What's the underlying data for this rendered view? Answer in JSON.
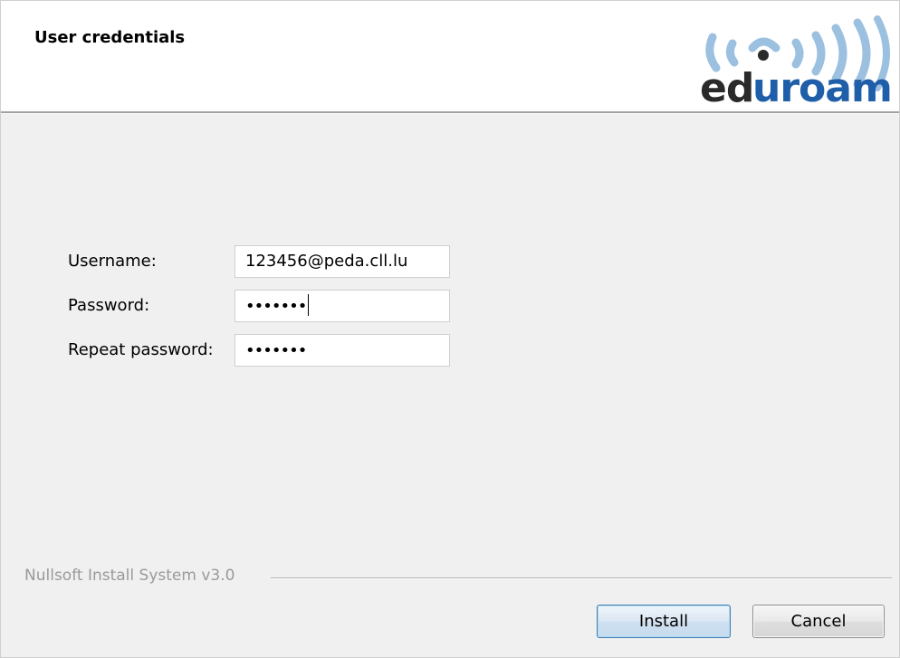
{
  "header": {
    "title": "User credentials",
    "logo_text_prefix": "ed",
    "logo_text_highlight": "uroam",
    "logo_text": "eduroam"
  },
  "form": {
    "username_label": "Username:",
    "username_value": "123456@peda.cll.lu",
    "password_label": "Password:",
    "password_masked": "•••••••",
    "repeat_password_label": "Repeat password:",
    "repeat_password_masked": "•••••••"
  },
  "footer": {
    "branding": "Nullsoft Install System v3.0",
    "install_label": "Install",
    "cancel_label": "Cancel"
  },
  "colors": {
    "logo_dark": "#2a2a2a",
    "logo_blue": "#1f5ea8",
    "logo_waves": "#9cc0e0"
  }
}
